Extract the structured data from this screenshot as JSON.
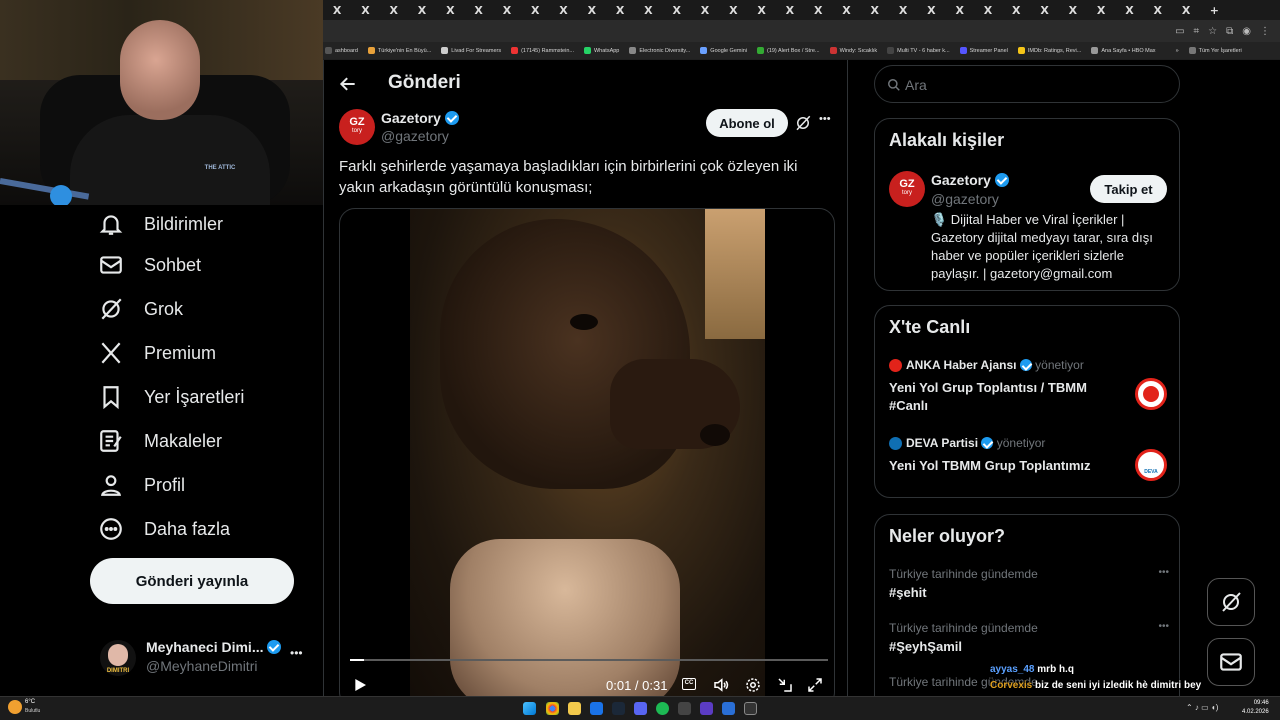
{
  "browser": {
    "tab_glyph": "X",
    "tab_count": 31,
    "new_tab": "+",
    "bookmarks": [
      {
        "label": "ashboard",
        "color": "#555"
      },
      {
        "label": "Türkiye'nin En Büyü...",
        "color": "#e8a13a"
      },
      {
        "label": "Livad For Streamers",
        "color": "#ccc"
      },
      {
        "label": "(17145) Rammstein...",
        "color": "#e33"
      },
      {
        "label": "WhatsApp",
        "color": "#25d366"
      },
      {
        "label": "Electronic Diversity...",
        "color": "#888"
      },
      {
        "label": "Google Gemini",
        "color": "#6aa0ff"
      },
      {
        "label": "(19) Alert Box / Stre...",
        "color": "#3a3"
      },
      {
        "label": "Windy: Sıcaklık",
        "color": "#c33"
      },
      {
        "label": "Multi TV - 6 haber k...",
        "color": "#444"
      },
      {
        "label": "Streamer Panel",
        "color": "#55f"
      },
      {
        "label": "IMDb: Ratings, Revi...",
        "color": "#f5c518"
      },
      {
        "label": "Ana Sayfa • HBO Max",
        "color": "#999"
      },
      {
        "label": "»",
        "color": "transparent"
      },
      {
        "label": "Tüm Yer İşaretleri",
        "color": "#777"
      }
    ]
  },
  "webcam": {
    "shirt_text": "THE ATTIC"
  },
  "sidebar": {
    "items": [
      {
        "label": "Bildirimler",
        "icon": "bell-icon"
      },
      {
        "label": "Sohbet",
        "icon": "mail-icon"
      },
      {
        "label": "Grok",
        "icon": "grok-icon"
      },
      {
        "label": "Premium",
        "icon": "x-logo-icon"
      },
      {
        "label": "Yer İşaretleri",
        "icon": "bookmark-icon"
      },
      {
        "label": "Makaleler",
        "icon": "article-icon"
      },
      {
        "label": "Profil",
        "icon": "profile-icon"
      },
      {
        "label": "Daha fazla",
        "icon": "more-icon"
      }
    ],
    "post_button": "Gönderi yayınla",
    "account": {
      "name": "Meyhaneci Dimi...",
      "handle": "@MeyhaneDimitri",
      "more": "•••",
      "avatar_text": "DIMITRI"
    }
  },
  "main": {
    "header": "Gönderi",
    "author": {
      "name": "Gazetory",
      "handle": "@gazetory",
      "avatar_text": "GZ",
      "avatar_sub": "tory"
    },
    "subscribe": "Abone ol",
    "more": "•••",
    "text": "Farklı şehirlerde yaşamaya başladıkları için birbirlerini çok özleyen iki yakın arkadaşın görüntülü konuşması;",
    "video": {
      "time": "0:01 / 0:31",
      "progress": 0.03,
      "cc": "CC"
    }
  },
  "right": {
    "search_placeholder": "Ara",
    "related": {
      "title": "Alakalı kişiler",
      "name": "Gazetory",
      "handle": "@gazetory",
      "follow": "Takip et",
      "bio": "🎙️ Dijital Haber ve Viral İçerikler | Gazetory dijital medyayı tarar, sıra dışı haber ve popüler içerikleri sizlerle paylaşır. | gazetory@gmail.com",
      "avatar_text": "GZ",
      "avatar_sub": "tory"
    },
    "live": {
      "title": "X'te Canlı",
      "items": [
        {
          "host": "ANKA Haber Ajansı",
          "role": "yönetiyor",
          "title": "Yeni Yol Grup Toplantısı / TBMM #Canlı",
          "color": "#e2231a"
        },
        {
          "host": "DEVA Partisi",
          "role": "yönetiyor",
          "title": "Yeni Yol TBMM Grup Toplantımız",
          "color": "#0f6fb3",
          "badge": "DEVA"
        }
      ]
    },
    "trends": {
      "title": "Neler oluyor?",
      "items": [
        {
          "context": "Türkiye tarihinde gündemde",
          "tag": "#şehit"
        },
        {
          "context": "Türkiye tarihinde gündemde",
          "tag": "#ŞeyhŞamil"
        },
        {
          "context": "Türkiye tarihinde gündemde",
          "tag": ""
        }
      ],
      "more": "•••"
    }
  },
  "chat": [
    {
      "user": "ayyas_48",
      "user_color": "#5aa0ff",
      "msg": "mrb h.q"
    },
    {
      "user": "Corvexis",
      "user_color": "#e0a020",
      "msg": "biz de seni iyi izledik hè dimitri bey"
    }
  ],
  "taskbar": {
    "weather_temp": "6°C",
    "weather_text": "Bulutlu",
    "time": "09:46",
    "date": "4.02.2026"
  }
}
